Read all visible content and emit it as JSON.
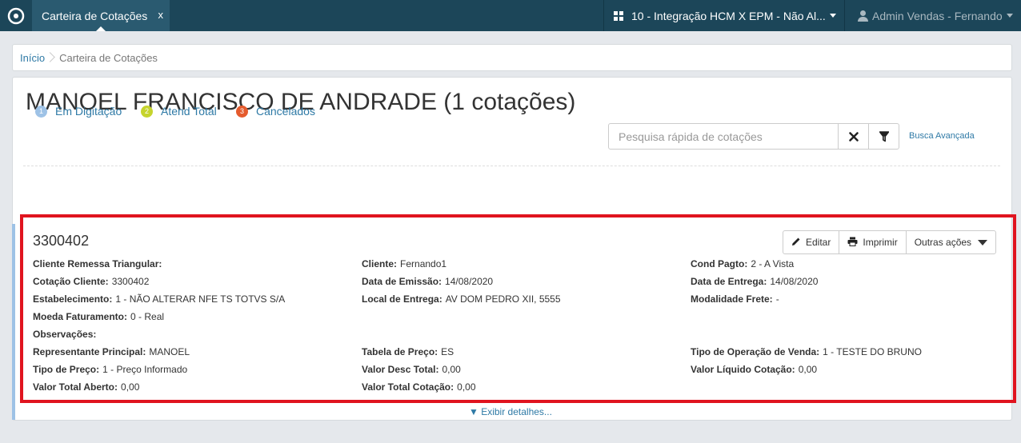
{
  "topbar": {
    "tab_label": "Carteira de Cotações",
    "tab_close": "x",
    "company": "10 - Integração HCM X EPM - Não Al...",
    "user": "Admin Vendas - Fernando"
  },
  "breadcrumb": {
    "home": "Início",
    "current": "Carteira de Cotações"
  },
  "page": {
    "title": "MANOEL FRANCISCO DE ANDRADE (1 cotações)"
  },
  "search": {
    "placeholder": "Pesquisa rápida de cotações",
    "advanced": "Busca Avançada"
  },
  "legend": [
    {
      "num": "1",
      "label": "Em Digitação",
      "color": "#9ec2e6"
    },
    {
      "num": "2",
      "label": "Atend Total",
      "color": "#c6d42d"
    },
    {
      "num": "3",
      "label": "Cancelados",
      "color": "#e55b2d"
    }
  ],
  "card": {
    "id": "3300402",
    "actions": {
      "edit": "Editar",
      "print": "Imprimir",
      "other": "Outras ações"
    },
    "fields": {
      "remessa": {
        "label": "Cliente Remessa Triangular:",
        "value": ""
      },
      "cotacao_cliente": {
        "label": "Cotação Cliente:",
        "value": "3300402"
      },
      "estabelecimento": {
        "label": "Estabelecimento:",
        "value": "1 - NÃO ALTERAR NFE TS TOTVS S/A"
      },
      "moeda": {
        "label": "Moeda Faturamento:",
        "value": "0 - Real"
      },
      "observacoes": {
        "label": "Observações:",
        "value": ""
      },
      "representante": {
        "label": "Representante Principal:",
        "value": "MANOEL"
      },
      "tipo_preco": {
        "label": "Tipo de Preço:",
        "value": "1 - Preço Informado"
      },
      "valor_aberto": {
        "label": "Valor Total Aberto:",
        "value": "0,00"
      },
      "cliente": {
        "label": "Cliente:",
        "value": "Fernando1"
      },
      "data_emissao": {
        "label": "Data de Emissão:",
        "value": "14/08/2020"
      },
      "local_entrega": {
        "label": "Local de Entrega:",
        "value": "AV DOM PEDRO XII, 5555"
      },
      "tabela_preco": {
        "label": "Tabela de Preço:",
        "value": "ES"
      },
      "valor_desc": {
        "label": "Valor Desc Total:",
        "value": "0,00"
      },
      "valor_cotacao": {
        "label": "Valor Total Cotação:",
        "value": "0,00"
      },
      "cond_pagto": {
        "label": "Cond Pagto:",
        "value": "2 - A Vista"
      },
      "data_entrega": {
        "label": "Data de Entrega:",
        "value": "14/08/2020"
      },
      "modalidade_frete": {
        "label": "Modalidade Frete:",
        "value": "-"
      },
      "tipo_operacao": {
        "label": "Tipo de Operação de Venda:",
        "value": "1 - TESTE DO BRUNO"
      },
      "valor_liquido": {
        "label": "Valor Líquido Cotação:",
        "value": "0,00"
      }
    },
    "details_link": "▼ Exibir detalhes..."
  },
  "colors": {
    "topbar": "#1c4659",
    "active_tab": "#2a5a70",
    "link": "#2f7aa6",
    "highlight_border": "#e0141f"
  }
}
